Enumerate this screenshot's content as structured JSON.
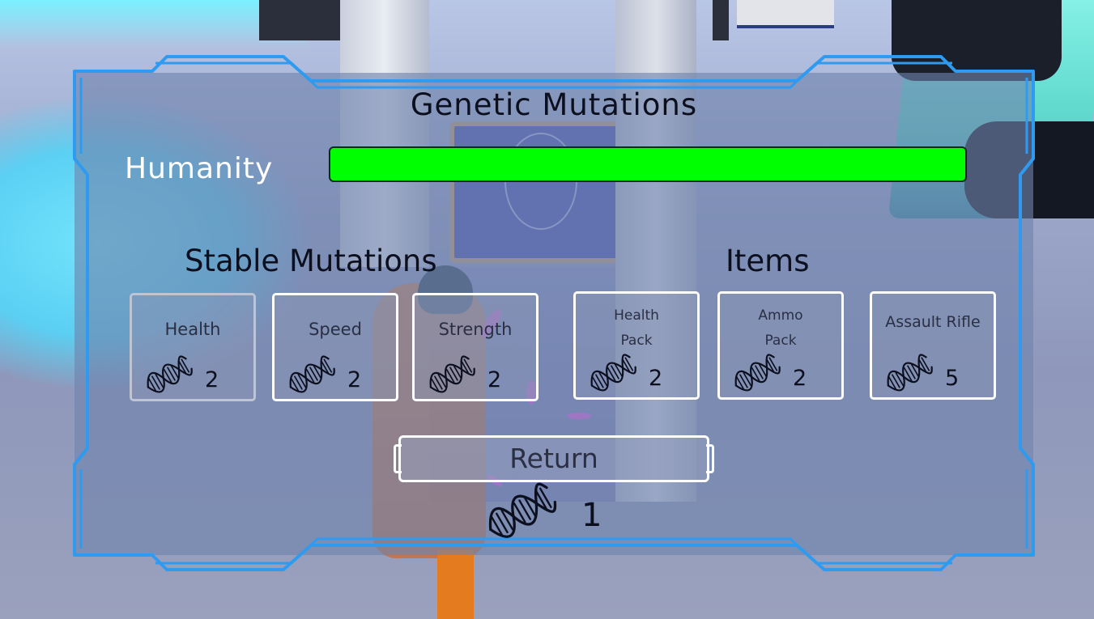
{
  "hud": {
    "title": "Genetic Mutations",
    "humanity": {
      "label": "Humanity",
      "level": 1.0,
      "bar_color": "#00ff00"
    },
    "stable_mutations": {
      "heading": "Stable Mutations",
      "cards": [
        {
          "name": "Health",
          "cost": "2"
        },
        {
          "name": "Speed",
          "cost": "2"
        },
        {
          "name": "Strength",
          "cost": "2"
        }
      ]
    },
    "items": {
      "heading": "Items",
      "cards": [
        {
          "name_line1": "Health",
          "name_line2": "Pack",
          "cost": "2"
        },
        {
          "name_line1": "Ammo",
          "name_line2": "Pack",
          "cost": "2"
        },
        {
          "name": "Assault Rifle",
          "cost": "5"
        }
      ]
    },
    "return_label": "Return",
    "dna_points": "1",
    "icons": {
      "currency": "dna-icon"
    },
    "colors": {
      "frame": "#2f9bf0",
      "panel": "#7082ac",
      "text": "#0b0f1e"
    }
  }
}
